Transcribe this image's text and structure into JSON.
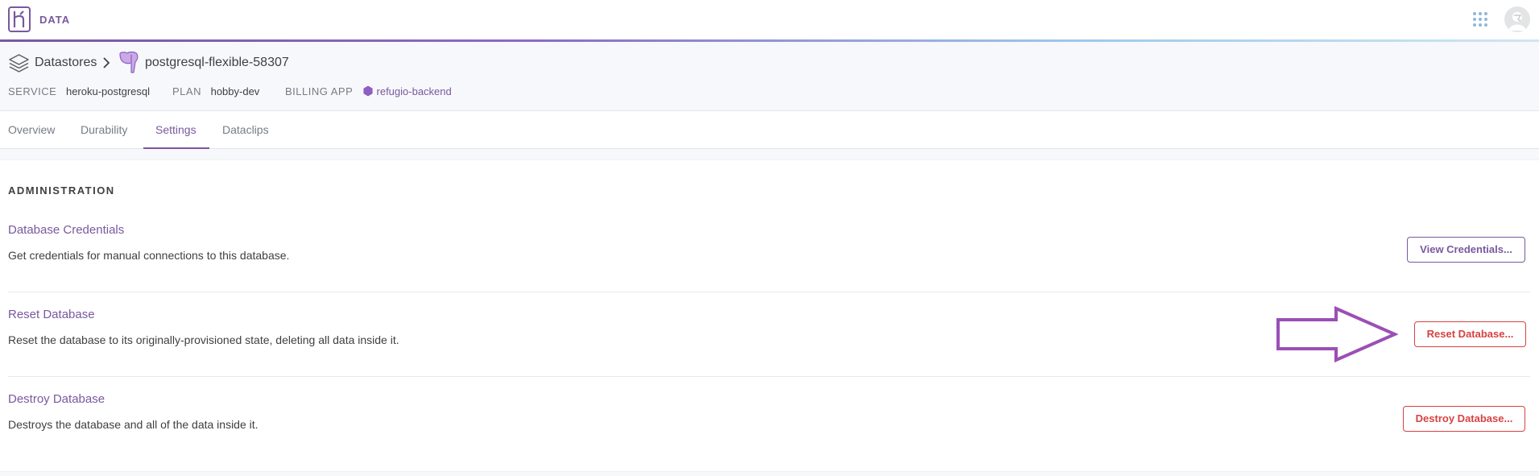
{
  "topbar": {
    "app_name": "DATA",
    "logo_icon": "heroku-logo-icon",
    "apps_icon": "grid-apps-icon",
    "avatar_icon": "user-avatar-icon"
  },
  "breadcrumb": {
    "root": "Datastores",
    "current": "postgresql-flexible-58307",
    "root_icon": "stacked-layers-icon",
    "resource_icon": "postgres-elephant-icon"
  },
  "meta": {
    "service_label": "SERVICE",
    "service_value": "heroku-postgresql",
    "plan_label": "PLAN",
    "plan_value": "hobby-dev",
    "billing_label": "BILLING APP",
    "billing_value": "refugio-backend"
  },
  "tabs": [
    {
      "label": "Overview"
    },
    {
      "label": "Durability"
    },
    {
      "label": "Settings"
    },
    {
      "label": "Dataclips"
    }
  ],
  "administration": {
    "title": "ADMINISTRATION",
    "rows": [
      {
        "title": "Database Credentials",
        "description": "Get credentials for manual connections to this database.",
        "button": "View Credentials..."
      },
      {
        "title": "Reset Database",
        "description": "Reset the database to its originally-provisioned state, deleting all data inside it.",
        "button": "Reset Database..."
      },
      {
        "title": "Destroy Database",
        "description": "Destroys the database and all of the data inside it.",
        "button": "Destroy Database..."
      }
    ]
  },
  "colors": {
    "accent": "#79589f",
    "danger": "#d64242",
    "annotation_arrow": "#9b4fb5"
  }
}
